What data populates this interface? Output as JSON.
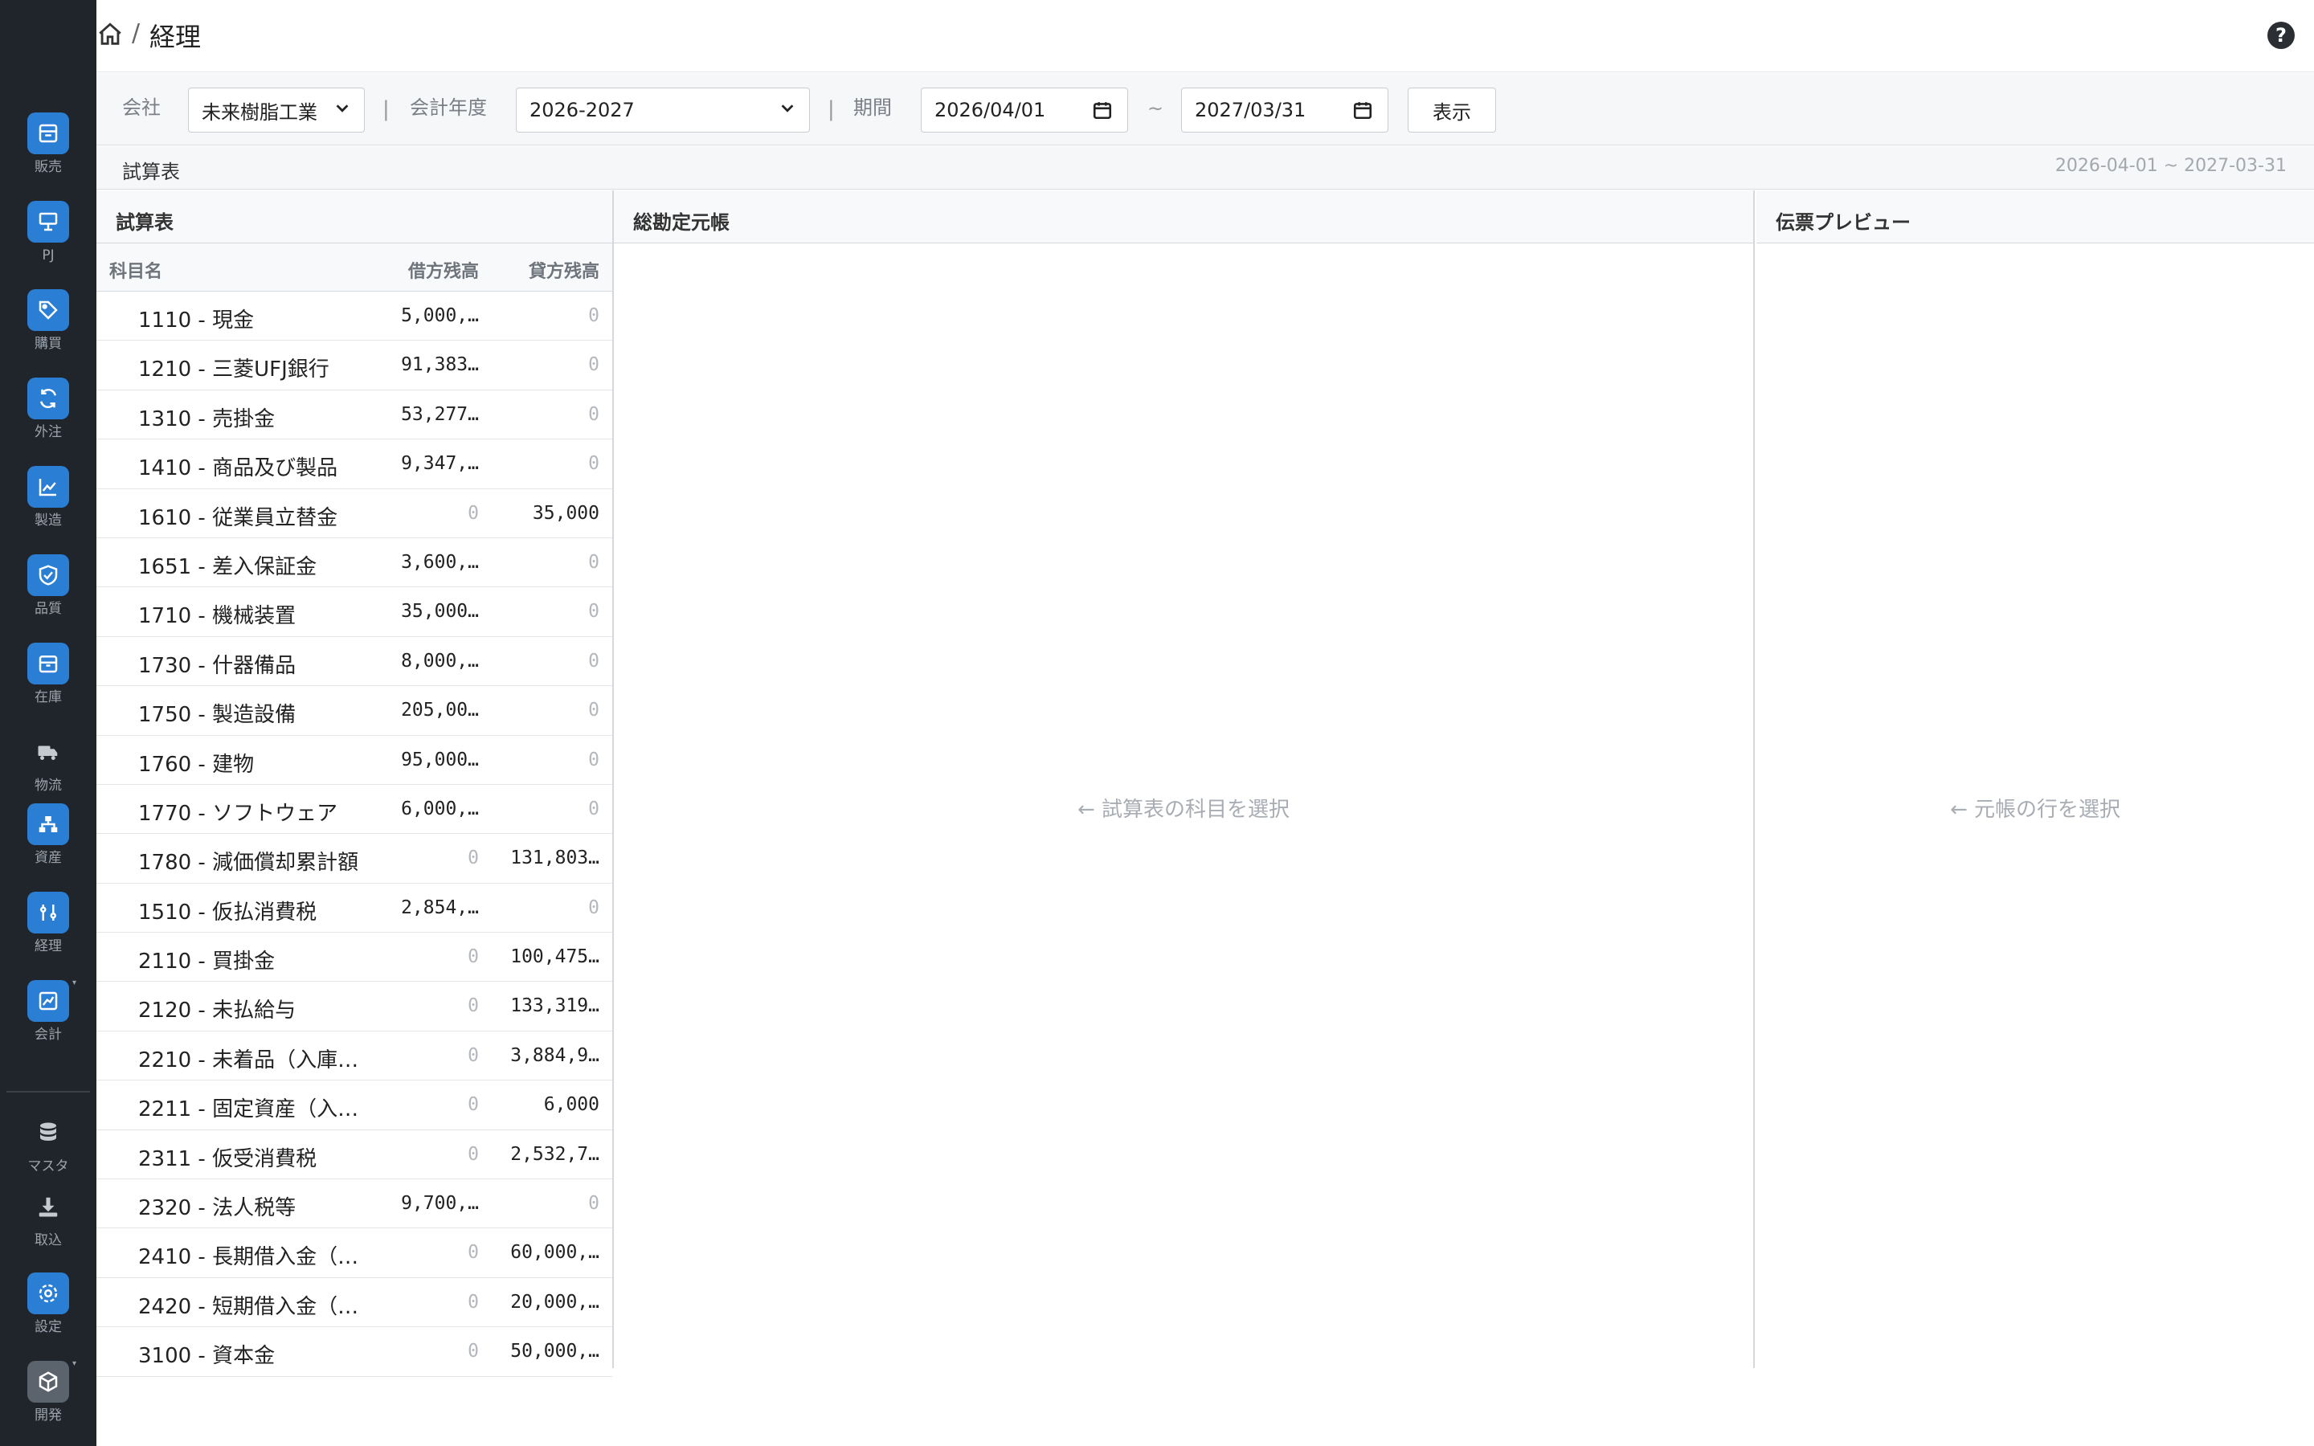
{
  "sidebar": {
    "items": [
      {
        "label": "販売",
        "icon": "register-icon"
      },
      {
        "label": "PJ",
        "icon": "presentation-icon"
      },
      {
        "label": "購買",
        "icon": "tag-icon"
      },
      {
        "label": "外注",
        "icon": "refresh-icon"
      },
      {
        "label": "製造",
        "icon": "factory-chart-icon"
      },
      {
        "label": "品質",
        "icon": "shield-check-icon"
      },
      {
        "label": "在庫",
        "icon": "box-icon"
      },
      {
        "label": "物流",
        "icon": "truck-icon"
      },
      {
        "label": "資産",
        "icon": "hierarchy-icon"
      },
      {
        "label": "経理",
        "icon": "sliders-icon"
      },
      {
        "label": "会計",
        "icon": "chart-line-icon"
      },
      {
        "label": "マスタ",
        "icon": "database-icon"
      },
      {
        "label": "取込",
        "icon": "download-icon"
      },
      {
        "label": "設定",
        "icon": "gear-icon"
      },
      {
        "label": "開発",
        "icon": "cube-icon"
      }
    ]
  },
  "header": {
    "separator": "/",
    "title": "経理",
    "help": "?"
  },
  "filters": {
    "company_label": "会社",
    "company_value": "未来樹脂工業",
    "fiscal_year_label": "会計年度",
    "fiscal_year_value": "2026-2027",
    "period_label": "期間",
    "date_from": "2026/04/01",
    "tilde": "~",
    "date_to": "2027/03/31",
    "show_button": "表示",
    "sep": "|"
  },
  "section": {
    "title": "試算表",
    "range": "2026-04-01 ~ 2027-03-31"
  },
  "panels": {
    "trial_balance": {
      "title": "試算表",
      "columns": {
        "name": "科目名",
        "debit": "借方残高",
        "credit": "貸方残高"
      },
      "rows": [
        {
          "name": "1110 - 現金",
          "debit": "5,000,…",
          "credit": "0"
        },
        {
          "name": "1210 - 三菱UFJ銀行",
          "debit": "91,383…",
          "credit": "0"
        },
        {
          "name": "1310 - 売掛金",
          "debit": "53,277…",
          "credit": "0"
        },
        {
          "name": "1410 - 商品及び製品",
          "debit": "9,347,…",
          "credit": "0"
        },
        {
          "name": "1610 - 従業員立替金",
          "debit": "0",
          "credit": "35,000"
        },
        {
          "name": "1651 - 差入保証金",
          "debit": "3,600,…",
          "credit": "0"
        },
        {
          "name": "1710 - 機械装置",
          "debit": "35,000…",
          "credit": "0"
        },
        {
          "name": "1730 - 什器備品",
          "debit": "8,000,…",
          "credit": "0"
        },
        {
          "name": "1750 - 製造設備",
          "debit": "205,00…",
          "credit": "0"
        },
        {
          "name": "1760 - 建物",
          "debit": "95,000…",
          "credit": "0"
        },
        {
          "name": "1770 - ソフトウェア",
          "debit": "6,000,…",
          "credit": "0"
        },
        {
          "name": "1780 - 減価償却累計額",
          "debit": "0",
          "credit": "131,803…"
        },
        {
          "name": "1510 - 仮払消費税",
          "debit": "2,854,…",
          "credit": "0"
        },
        {
          "name": "2110 - 買掛金",
          "debit": "0",
          "credit": "100,475…"
        },
        {
          "name": "2120 - 未払給与",
          "debit": "0",
          "credit": "133,319…"
        },
        {
          "name": "2210 - 未着品（入庫…",
          "debit": "0",
          "credit": "3,884,9…"
        },
        {
          "name": "2211 - 固定資産（入…",
          "debit": "0",
          "credit": "6,000"
        },
        {
          "name": "2311 - 仮受消費税",
          "debit": "0",
          "credit": "2,532,7…"
        },
        {
          "name": "2320 - 法人税等",
          "debit": "9,700,…",
          "credit": "0"
        },
        {
          "name": "2410 - 長期借入金（…",
          "debit": "0",
          "credit": "60,000,…"
        },
        {
          "name": "2420 - 短期借入金（…",
          "debit": "0",
          "credit": "20,000,…"
        },
        {
          "name": "3100 - 資本金",
          "debit": "0",
          "credit": "50,000,…"
        }
      ]
    },
    "general_ledger": {
      "title": "総勘定元帳",
      "placeholder": "← 試算表の科目を選択"
    },
    "voucher_preview": {
      "title": "伝票プレビュー",
      "placeholder": "← 元帳の行を選択"
    }
  },
  "colors": {
    "sidebar_bg": "#20252b",
    "accent": "#2a7fd4"
  }
}
